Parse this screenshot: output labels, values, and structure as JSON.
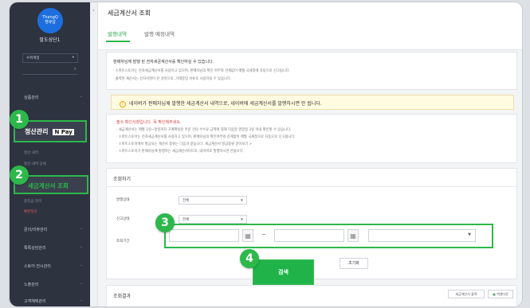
{
  "sidebar": {
    "logo_lines": [
      "ThangQ",
      "쟁큐샵"
    ],
    "shop_name": "팔도상단1",
    "store_select": "수퍼계정",
    "menu_product": "상품관리",
    "menu_settlement": "정산관리",
    "npay_label": "N Pay",
    "sub_settlement_1": "정산 내역",
    "sub_settlement_2": "정산 내역 상세",
    "menu_tax_invoice": "세금계산서 조회",
    "sub_charge": "충전금 관리",
    "sub_quick": "빠른정산",
    "menu_review": "문의/리뷰관리",
    "menu_talktalk": "톡톡상담관리",
    "menu_store": "스토어 전시관리",
    "menu_nochul": "노출관리",
    "menu_more": "고객혜택관리"
  },
  "page": {
    "title": "세금계산서 조회",
    "tabs": [
      "발행내역",
      "발행 예정내역"
    ],
    "active_tab": 0
  },
  "info": {
    "heading": "판매자님께 발행 된 전자세금계산서를 확인하실 수 있습니다.",
    "line1": "· 스마트스토어는 전자세금계산서를 사용하고 있으며, 판매자님의 확인 여부와 관계없이 매월 국세청에 자동으로 신고됩니다.",
    "line2": "· 출력된 계산서는 전자서명이 된 것이므로, 거래증빙 서류로 사용하실 수 있습니다."
  },
  "notice": "네이버가 판매자님께 발행한 세금계산서 내역으로, 네이버에 세금계산서를 발행하시면 안 됩니다.",
  "must": {
    "heading": "필수 확인사항입니다. 꼭 확인해주세요.",
    "lines": [
      "· 세금계산서는 매월 1일~말일까지 구매확정된 주문 건의 수수료 금액에 대해 다음달 영업일 3일 이내 확인할 수 있습니다.",
      "· 스마트스토어는 전자세금계산서를 사용하고 있으며, 판매자님의 확인여부와 관계없이 매월 국세청으로 자동으로 신고됩니다.",
      "· 스마트스토어에서 발급되는 계산서 종류는 다음과 같습니다. 세금계산서 발급종류 알아보기 >",
      "· 스마트스토어가 판매자님께 발행하는 세금계산서이므로, 네이버로 발행하시면 안됩니다."
    ]
  },
  "search": {
    "section_title": "조회하기",
    "label_status": "발행상태",
    "value_status": "전체",
    "label_report": "신고상태",
    "value_report": "전체",
    "label_period": "조회기간",
    "dash": "~",
    "search_button": "검색",
    "reset_button": "초기화"
  },
  "result": {
    "title": "조회결과",
    "print_button": "세금계산서 출력",
    "excel_button": "엑셀다운"
  },
  "badges": [
    "1",
    "2",
    "3",
    "4"
  ],
  "colors": {
    "accent": "#2db84b",
    "sidebar": "#2e3340",
    "notice_bg": "#fffbe0"
  }
}
